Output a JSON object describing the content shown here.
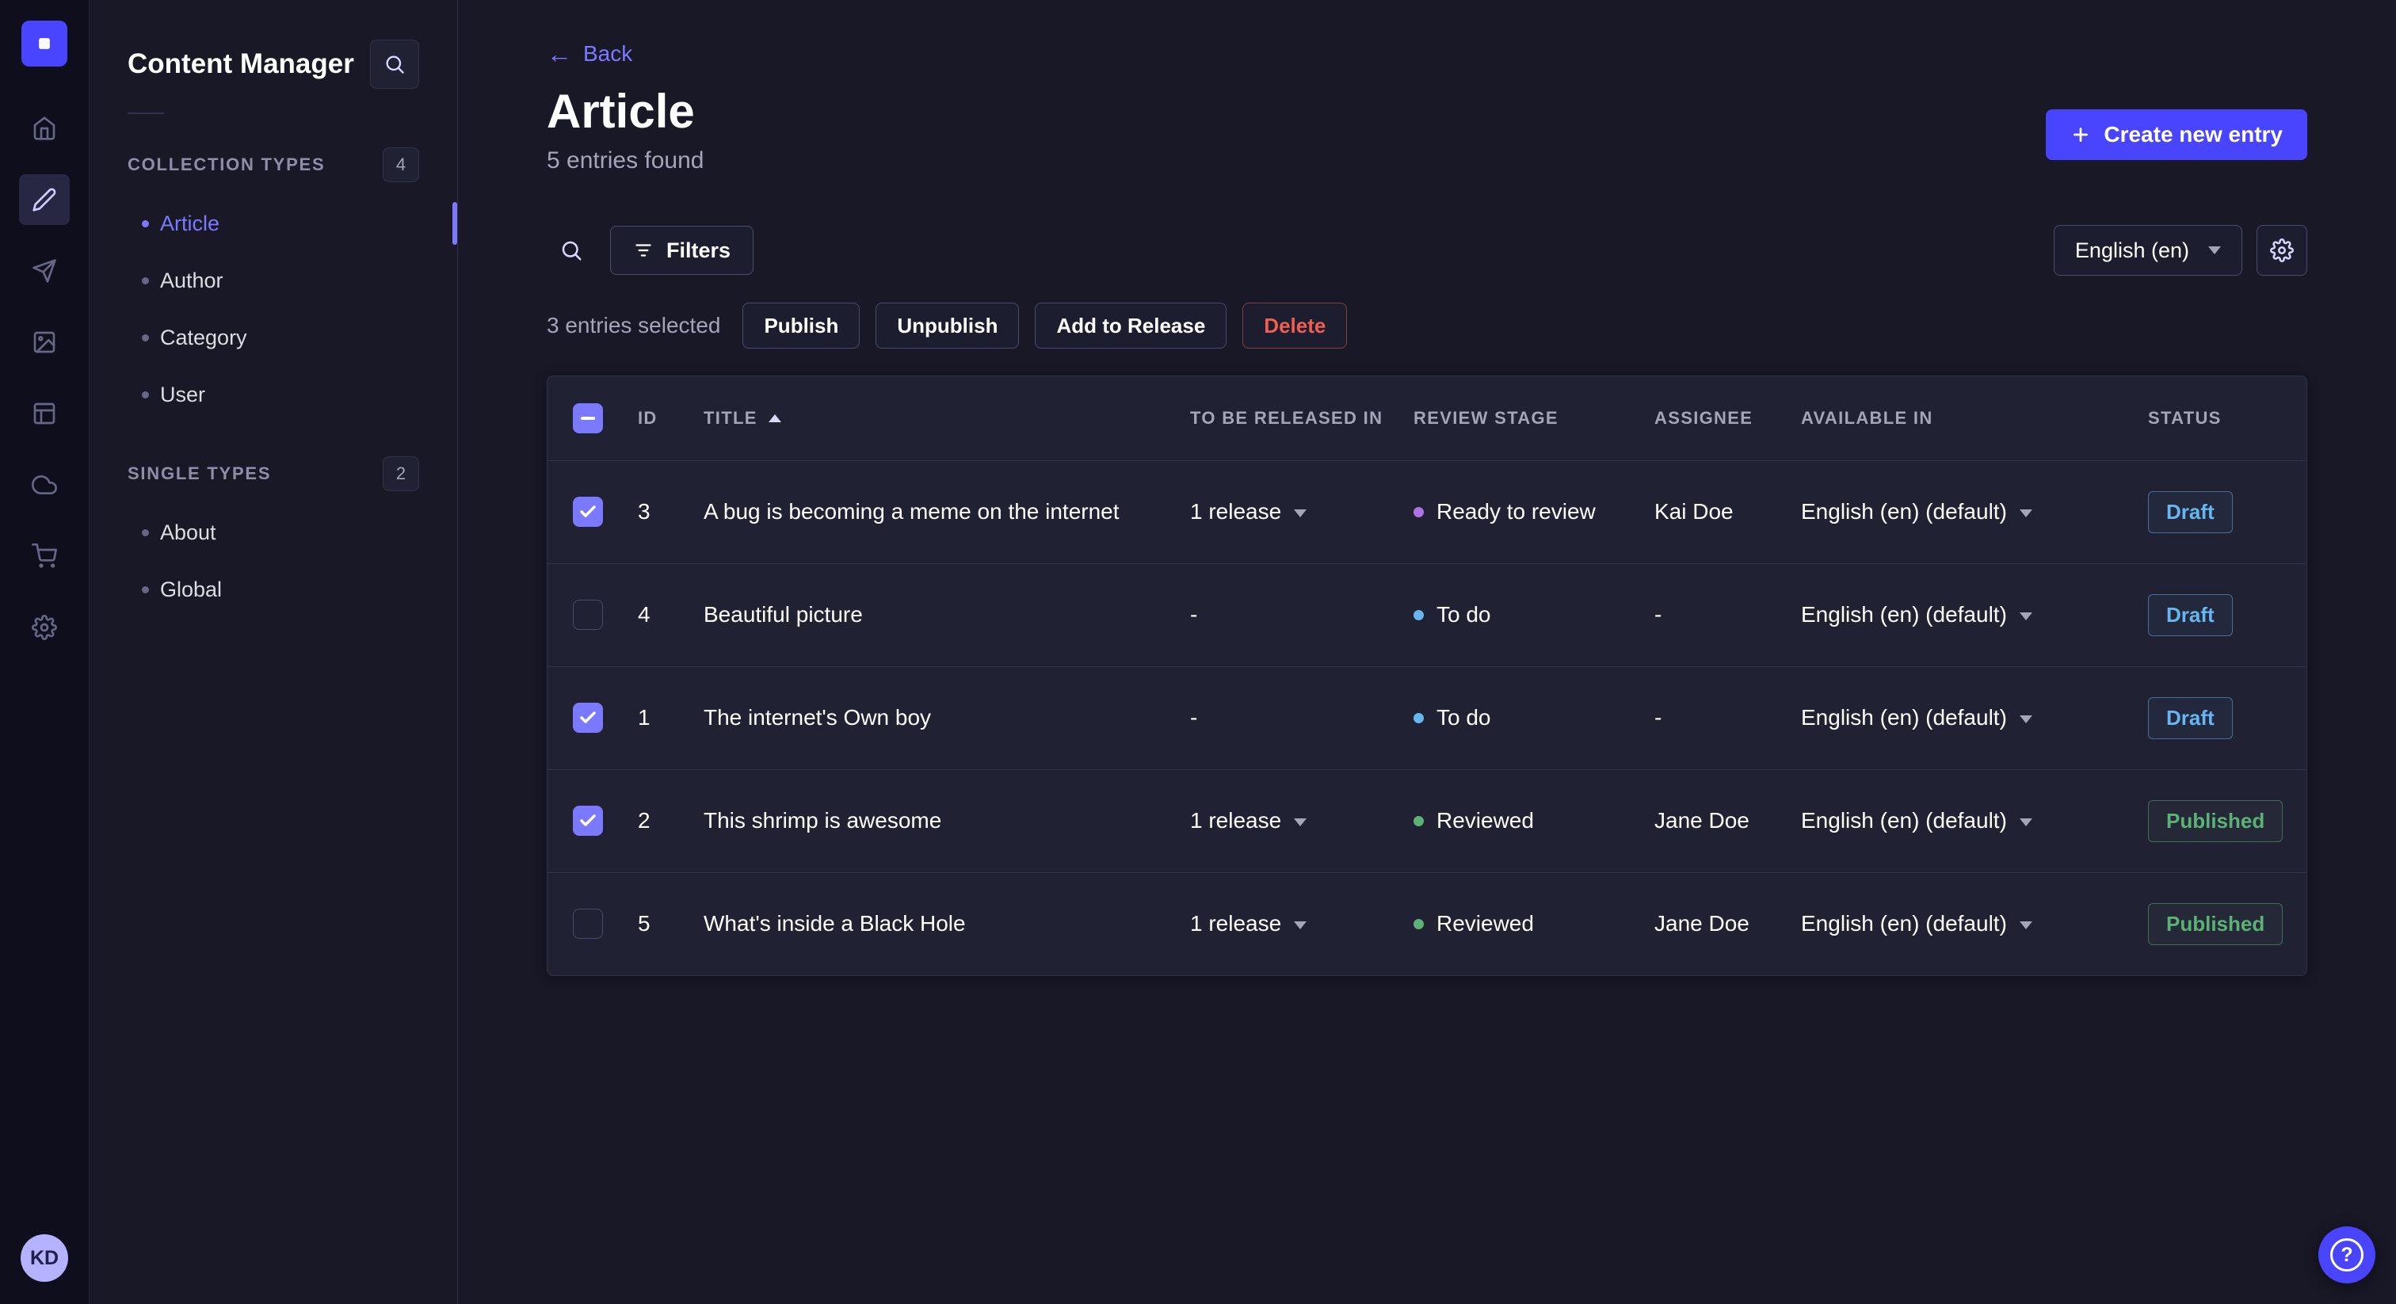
{
  "rail": {
    "icons": [
      "strapi-logo",
      "home",
      "content-manager",
      "releases",
      "media-library",
      "content-type-builder",
      "cloud",
      "marketplace",
      "settings"
    ],
    "active": "content-manager"
  },
  "user": {
    "initials": "KD"
  },
  "sidebar": {
    "title": "Content Manager",
    "sections": [
      {
        "label": "COLLECTION TYPES",
        "badge": "4",
        "items": [
          {
            "label": "Article",
            "active": "true"
          },
          {
            "label": "Author",
            "active": "false"
          },
          {
            "label": "Category",
            "active": "false"
          },
          {
            "label": "User",
            "active": "false"
          }
        ]
      },
      {
        "label": "SINGLE TYPES",
        "badge": "2",
        "items": [
          {
            "label": "About",
            "active": "false"
          },
          {
            "label": "Global",
            "active": "false"
          }
        ]
      }
    ]
  },
  "header": {
    "back_arrow": "←",
    "back": "Back",
    "title": "Article",
    "subtitle": "5 entries found",
    "create": "Create new entry"
  },
  "toolbar": {
    "filters": "Filters",
    "locale": "English (en)"
  },
  "selection": {
    "count_label": "3 entries selected",
    "publish": "Publish",
    "unpublish": "Unpublish",
    "add_to_release": "Add to Release",
    "delete": "Delete"
  },
  "table": {
    "select_all": "indeterminate",
    "sort": {
      "column": "TITLE",
      "direction": "asc"
    },
    "columns": {
      "id": "ID",
      "title": "TITLE",
      "released": "TO BE RELEASED IN",
      "review_stage": "REVIEW STAGE",
      "assignee": "ASSIGNEE",
      "available_in": "AVAILABLE IN",
      "status": "STATUS"
    },
    "rows": [
      {
        "selected": "true",
        "id": "3",
        "title": "A bug is becoming a meme on the internet",
        "released": "1 release",
        "has_release": "true",
        "stage": "Ready to review",
        "stage_key": "ready",
        "assignee": "Kai Doe",
        "available": "English (en) (default)",
        "status": "Draft",
        "status_key": "draft"
      },
      {
        "selected": "false",
        "id": "4",
        "title": "Beautiful picture",
        "released": "-",
        "has_release": "false",
        "stage": "To do",
        "stage_key": "todo",
        "assignee": "-",
        "available": "English (en) (default)",
        "status": "Draft",
        "status_key": "draft"
      },
      {
        "selected": "true",
        "id": "1",
        "title": "The internet's Own boy",
        "released": "-",
        "has_release": "false",
        "stage": "To do",
        "stage_key": "todo",
        "assignee": "-",
        "available": "English (en) (default)",
        "status": "Draft",
        "status_key": "draft"
      },
      {
        "selected": "true",
        "id": "2",
        "title": "This shrimp is awesome",
        "released": "1 release",
        "has_release": "true",
        "stage": "Reviewed",
        "stage_key": "reviewed",
        "assignee": "Jane Doe",
        "available": "English (en) (default)",
        "status": "Published",
        "status_key": "published"
      },
      {
        "selected": "false",
        "id": "5",
        "title": "What's inside a Black Hole",
        "released": "1 release",
        "has_release": "true",
        "stage": "Reviewed",
        "stage_key": "reviewed",
        "assignee": "Jane Doe",
        "available": "English (en) (default)",
        "status": "Published",
        "status_key": "published"
      }
    ]
  },
  "fab": {
    "glyph": "?"
  },
  "colors": {
    "primary": "#4945ff",
    "primary_light": "#7b79ff",
    "draft": "#66b7f1",
    "published": "#5cb176",
    "danger": "#ee5e52",
    "stage_ready": "#ac73e6",
    "stage_todo": "#66b7f1",
    "stage_reviewed": "#5cb176"
  }
}
